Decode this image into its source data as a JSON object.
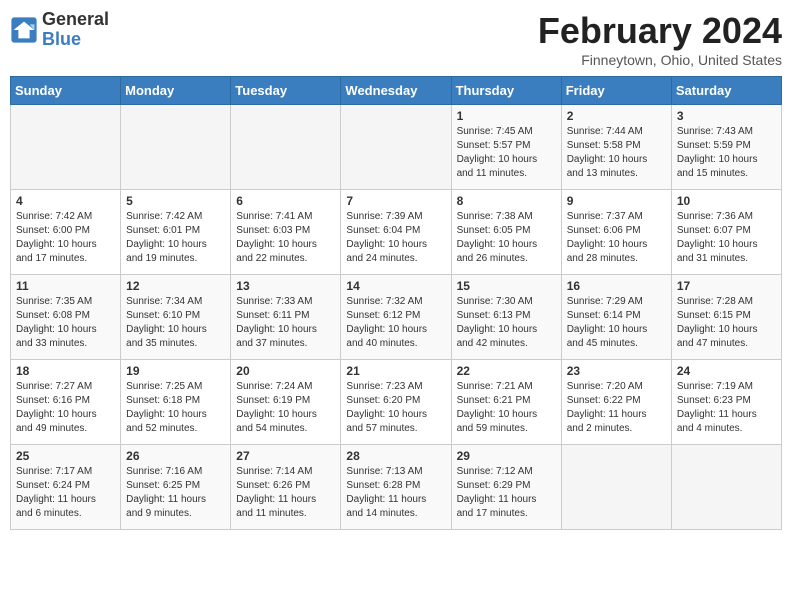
{
  "header": {
    "logo_general": "General",
    "logo_blue": "Blue",
    "title": "February 2024",
    "subtitle": "Finneytown, Ohio, United States"
  },
  "columns": [
    "Sunday",
    "Monday",
    "Tuesday",
    "Wednesday",
    "Thursday",
    "Friday",
    "Saturday"
  ],
  "weeks": [
    [
      {
        "day": "",
        "info": ""
      },
      {
        "day": "",
        "info": ""
      },
      {
        "day": "",
        "info": ""
      },
      {
        "day": "",
        "info": ""
      },
      {
        "day": "1",
        "info": "Sunrise: 7:45 AM\nSunset: 5:57 PM\nDaylight: 10 hours and 11 minutes."
      },
      {
        "day": "2",
        "info": "Sunrise: 7:44 AM\nSunset: 5:58 PM\nDaylight: 10 hours and 13 minutes."
      },
      {
        "day": "3",
        "info": "Sunrise: 7:43 AM\nSunset: 5:59 PM\nDaylight: 10 hours and 15 minutes."
      }
    ],
    [
      {
        "day": "4",
        "info": "Sunrise: 7:42 AM\nSunset: 6:00 PM\nDaylight: 10 hours and 17 minutes."
      },
      {
        "day": "5",
        "info": "Sunrise: 7:42 AM\nSunset: 6:01 PM\nDaylight: 10 hours and 19 minutes."
      },
      {
        "day": "6",
        "info": "Sunrise: 7:41 AM\nSunset: 6:03 PM\nDaylight: 10 hours and 22 minutes."
      },
      {
        "day": "7",
        "info": "Sunrise: 7:39 AM\nSunset: 6:04 PM\nDaylight: 10 hours and 24 minutes."
      },
      {
        "day": "8",
        "info": "Sunrise: 7:38 AM\nSunset: 6:05 PM\nDaylight: 10 hours and 26 minutes."
      },
      {
        "day": "9",
        "info": "Sunrise: 7:37 AM\nSunset: 6:06 PM\nDaylight: 10 hours and 28 minutes."
      },
      {
        "day": "10",
        "info": "Sunrise: 7:36 AM\nSunset: 6:07 PM\nDaylight: 10 hours and 31 minutes."
      }
    ],
    [
      {
        "day": "11",
        "info": "Sunrise: 7:35 AM\nSunset: 6:08 PM\nDaylight: 10 hours and 33 minutes."
      },
      {
        "day": "12",
        "info": "Sunrise: 7:34 AM\nSunset: 6:10 PM\nDaylight: 10 hours and 35 minutes."
      },
      {
        "day": "13",
        "info": "Sunrise: 7:33 AM\nSunset: 6:11 PM\nDaylight: 10 hours and 37 minutes."
      },
      {
        "day": "14",
        "info": "Sunrise: 7:32 AM\nSunset: 6:12 PM\nDaylight: 10 hours and 40 minutes."
      },
      {
        "day": "15",
        "info": "Sunrise: 7:30 AM\nSunset: 6:13 PM\nDaylight: 10 hours and 42 minutes."
      },
      {
        "day": "16",
        "info": "Sunrise: 7:29 AM\nSunset: 6:14 PM\nDaylight: 10 hours and 45 minutes."
      },
      {
        "day": "17",
        "info": "Sunrise: 7:28 AM\nSunset: 6:15 PM\nDaylight: 10 hours and 47 minutes."
      }
    ],
    [
      {
        "day": "18",
        "info": "Sunrise: 7:27 AM\nSunset: 6:16 PM\nDaylight: 10 hours and 49 minutes."
      },
      {
        "day": "19",
        "info": "Sunrise: 7:25 AM\nSunset: 6:18 PM\nDaylight: 10 hours and 52 minutes."
      },
      {
        "day": "20",
        "info": "Sunrise: 7:24 AM\nSunset: 6:19 PM\nDaylight: 10 hours and 54 minutes."
      },
      {
        "day": "21",
        "info": "Sunrise: 7:23 AM\nSunset: 6:20 PM\nDaylight: 10 hours and 57 minutes."
      },
      {
        "day": "22",
        "info": "Sunrise: 7:21 AM\nSunset: 6:21 PM\nDaylight: 10 hours and 59 minutes."
      },
      {
        "day": "23",
        "info": "Sunrise: 7:20 AM\nSunset: 6:22 PM\nDaylight: 11 hours and 2 minutes."
      },
      {
        "day": "24",
        "info": "Sunrise: 7:19 AM\nSunset: 6:23 PM\nDaylight: 11 hours and 4 minutes."
      }
    ],
    [
      {
        "day": "25",
        "info": "Sunrise: 7:17 AM\nSunset: 6:24 PM\nDaylight: 11 hours and 6 minutes."
      },
      {
        "day": "26",
        "info": "Sunrise: 7:16 AM\nSunset: 6:25 PM\nDaylight: 11 hours and 9 minutes."
      },
      {
        "day": "27",
        "info": "Sunrise: 7:14 AM\nSunset: 6:26 PM\nDaylight: 11 hours and 11 minutes."
      },
      {
        "day": "28",
        "info": "Sunrise: 7:13 AM\nSunset: 6:28 PM\nDaylight: 11 hours and 14 minutes."
      },
      {
        "day": "29",
        "info": "Sunrise: 7:12 AM\nSunset: 6:29 PM\nDaylight: 11 hours and 17 minutes."
      },
      {
        "day": "",
        "info": ""
      },
      {
        "day": "",
        "info": ""
      }
    ]
  ]
}
